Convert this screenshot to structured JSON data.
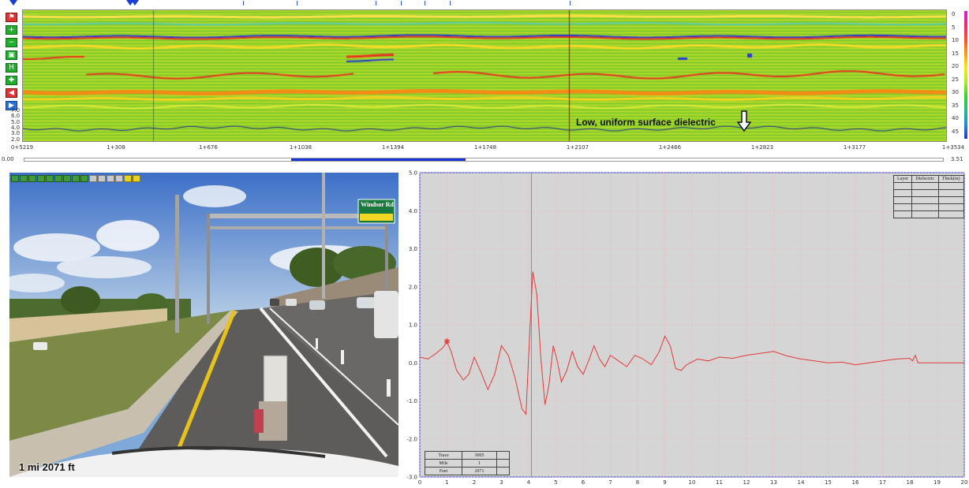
{
  "gpr": {
    "depth_ticks": [
      "0",
      "5",
      "10",
      "15",
      "20",
      "25",
      "30",
      "35",
      "40",
      "45"
    ],
    "dielectric_ticks": [
      "7.0",
      "6.0",
      "5.0",
      "4.0",
      "3.0",
      "2.0"
    ],
    "stations": [
      "0+5219",
      "1+308",
      "1+676",
      "1+1038",
      "1+1394",
      "1+1748",
      "1+2107",
      "1+2466",
      "1+2823",
      "1+3177",
      "1+3534"
    ],
    "scroll": {
      "start": "0.00",
      "end": "3.51",
      "thumb_start": 0.29,
      "thumb_end": 0.48
    },
    "annotation": "Low, uniform surface dielectric",
    "colors": {
      "background": "#9ad22a",
      "band_red": "#e8341f",
      "band_blue": "#2a3ad6",
      "band_orange": "#f58a14",
      "cursor_line": "#c00000",
      "dielectric_line": "#1a2a8c"
    },
    "tool_icons": [
      "flag-icon",
      "zoom-in-icon",
      "zoom-out-icon",
      "fit-icon",
      "marker-icon",
      "plus-icon",
      "play-left-icon",
      "play-right-icon"
    ]
  },
  "video": {
    "caption": "1 mi 2071 ft",
    "sign": "Windsor Rd",
    "toolbar_icons": [
      "skip-start-icon",
      "step-back-icon",
      "rewind-icon",
      "play-back-icon",
      "stop-icon",
      "play-icon",
      "fast-forward-icon",
      "step-forward-icon",
      "skip-end-icon",
      "loop-icon",
      "camera-icon",
      "settings-icon",
      "zoom-icon",
      "prev-frame-icon",
      "next-frame-icon"
    ]
  },
  "waveform": {
    "layer_table": {
      "headers": [
        "Layer",
        "Dielectric",
        "Thick(in)"
      ],
      "rows": [
        [
          "",
          "",
          ""
        ],
        [
          "",
          "",
          ""
        ],
        [
          "",
          "",
          ""
        ],
        [
          "",
          "",
          ""
        ],
        [
          "",
          "",
          ""
        ]
      ]
    },
    "trace_table": {
      "rows": [
        [
          "Trace",
          "3005",
          ""
        ],
        [
          "Mile",
          "1",
          ""
        ],
        [
          "Feet",
          "2071",
          ""
        ]
      ]
    },
    "chart_data": {
      "type": "line",
      "title": "",
      "xlabel": "",
      "ylabel": "",
      "xlim": [
        0,
        20
      ],
      "ylim": [
        -3.0,
        5.0
      ],
      "x_ticks": [
        "0",
        "1",
        "2",
        "3",
        "4",
        "5",
        "6",
        "7",
        "8",
        "9",
        "10",
        "11",
        "12",
        "13",
        "14",
        "15",
        "16",
        "17",
        "18",
        "19",
        "20"
      ],
      "y_ticks": [
        "-3.0",
        "-2.0",
        "-1.0",
        "0.0",
        "1.0",
        "2.0",
        "3.0",
        "4.0",
        "5.0"
      ],
      "cursor_x": 4.1,
      "peak_marker": {
        "x": 1.0,
        "y": 0.55
      },
      "series": [
        {
          "color": "#e33a3a",
          "x": [
            0,
            0.3,
            0.6,
            0.85,
            1.0,
            1.15,
            1.35,
            1.6,
            1.8,
            2.0,
            2.25,
            2.5,
            2.75,
            3.0,
            3.25,
            3.5,
            3.75,
            3.9,
            4.0,
            4.15,
            4.3,
            4.45,
            4.6,
            4.75,
            4.9,
            5.05,
            5.2,
            5.4,
            5.6,
            5.8,
            6.0,
            6.2,
            6.4,
            6.6,
            6.8,
            7.0,
            7.3,
            7.6,
            7.9,
            8.2,
            8.5,
            8.8,
            9.0,
            9.2,
            9.4,
            9.6,
            9.8,
            10.2,
            10.6,
            11.0,
            11.5,
            12.0,
            12.5,
            13.0,
            13.5,
            14.0,
            14.5,
            15.0,
            15.5,
            16.0,
            16.5,
            17.0,
            17.5,
            18.0,
            18.1,
            18.2,
            18.3,
            18.5,
            19.0,
            20.0
          ],
          "y": [
            0.15,
            0.1,
            0.25,
            0.4,
            0.55,
            0.3,
            -0.2,
            -0.45,
            -0.3,
            0.15,
            -0.25,
            -0.7,
            -0.3,
            0.45,
            0.2,
            -0.4,
            -1.2,
            -1.35,
            0.2,
            2.4,
            1.8,
            0.1,
            -1.1,
            -0.55,
            0.45,
            0.05,
            -0.5,
            -0.2,
            0.3,
            -0.1,
            -0.3,
            0.05,
            0.45,
            0.1,
            -0.1,
            0.2,
            0.05,
            -0.1,
            0.2,
            0.1,
            -0.05,
            0.3,
            0.7,
            0.45,
            -0.15,
            -0.2,
            -0.05,
            0.1,
            0.05,
            0.15,
            0.12,
            0.2,
            0.25,
            0.3,
            0.18,
            0.1,
            0.05,
            0.0,
            0.02,
            -0.05,
            0.0,
            0.05,
            0.1,
            0.12,
            0.05,
            0.2,
            0.0,
            0.0,
            0.0,
            0.0
          ]
        }
      ]
    }
  }
}
